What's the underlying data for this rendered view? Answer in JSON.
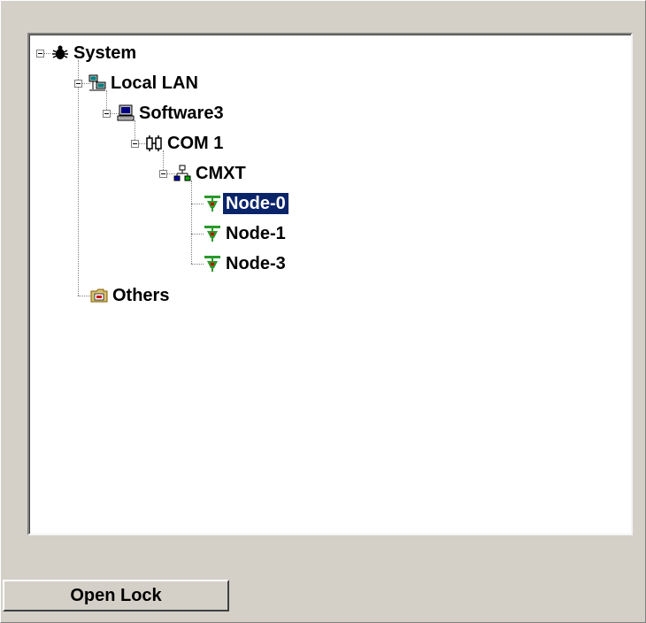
{
  "tree": {
    "items": [
      {
        "label": "System",
        "icon": "bug-icon"
      },
      {
        "label": "Local LAN",
        "icon": "network-computers-icon"
      },
      {
        "label": "Software3",
        "icon": "computer-icon"
      },
      {
        "label": "COM 1",
        "icon": "serial-port-icon"
      },
      {
        "label": "CMXT",
        "icon": "hierarchy-network-icon"
      },
      {
        "label": "Node-0",
        "icon": "node-device-icon",
        "selected": true
      },
      {
        "label": "Node-1",
        "icon": "node-device-icon"
      },
      {
        "label": "Node-3",
        "icon": "node-device-icon"
      },
      {
        "label": "Others",
        "icon": "folder-icon"
      }
    ]
  },
  "footer": {
    "open_lock_label": "Open Lock"
  },
  "colors": {
    "selection": "#0a246a",
    "window_bg": "#d4d0c8",
    "node_green": "#2a9a2a"
  }
}
